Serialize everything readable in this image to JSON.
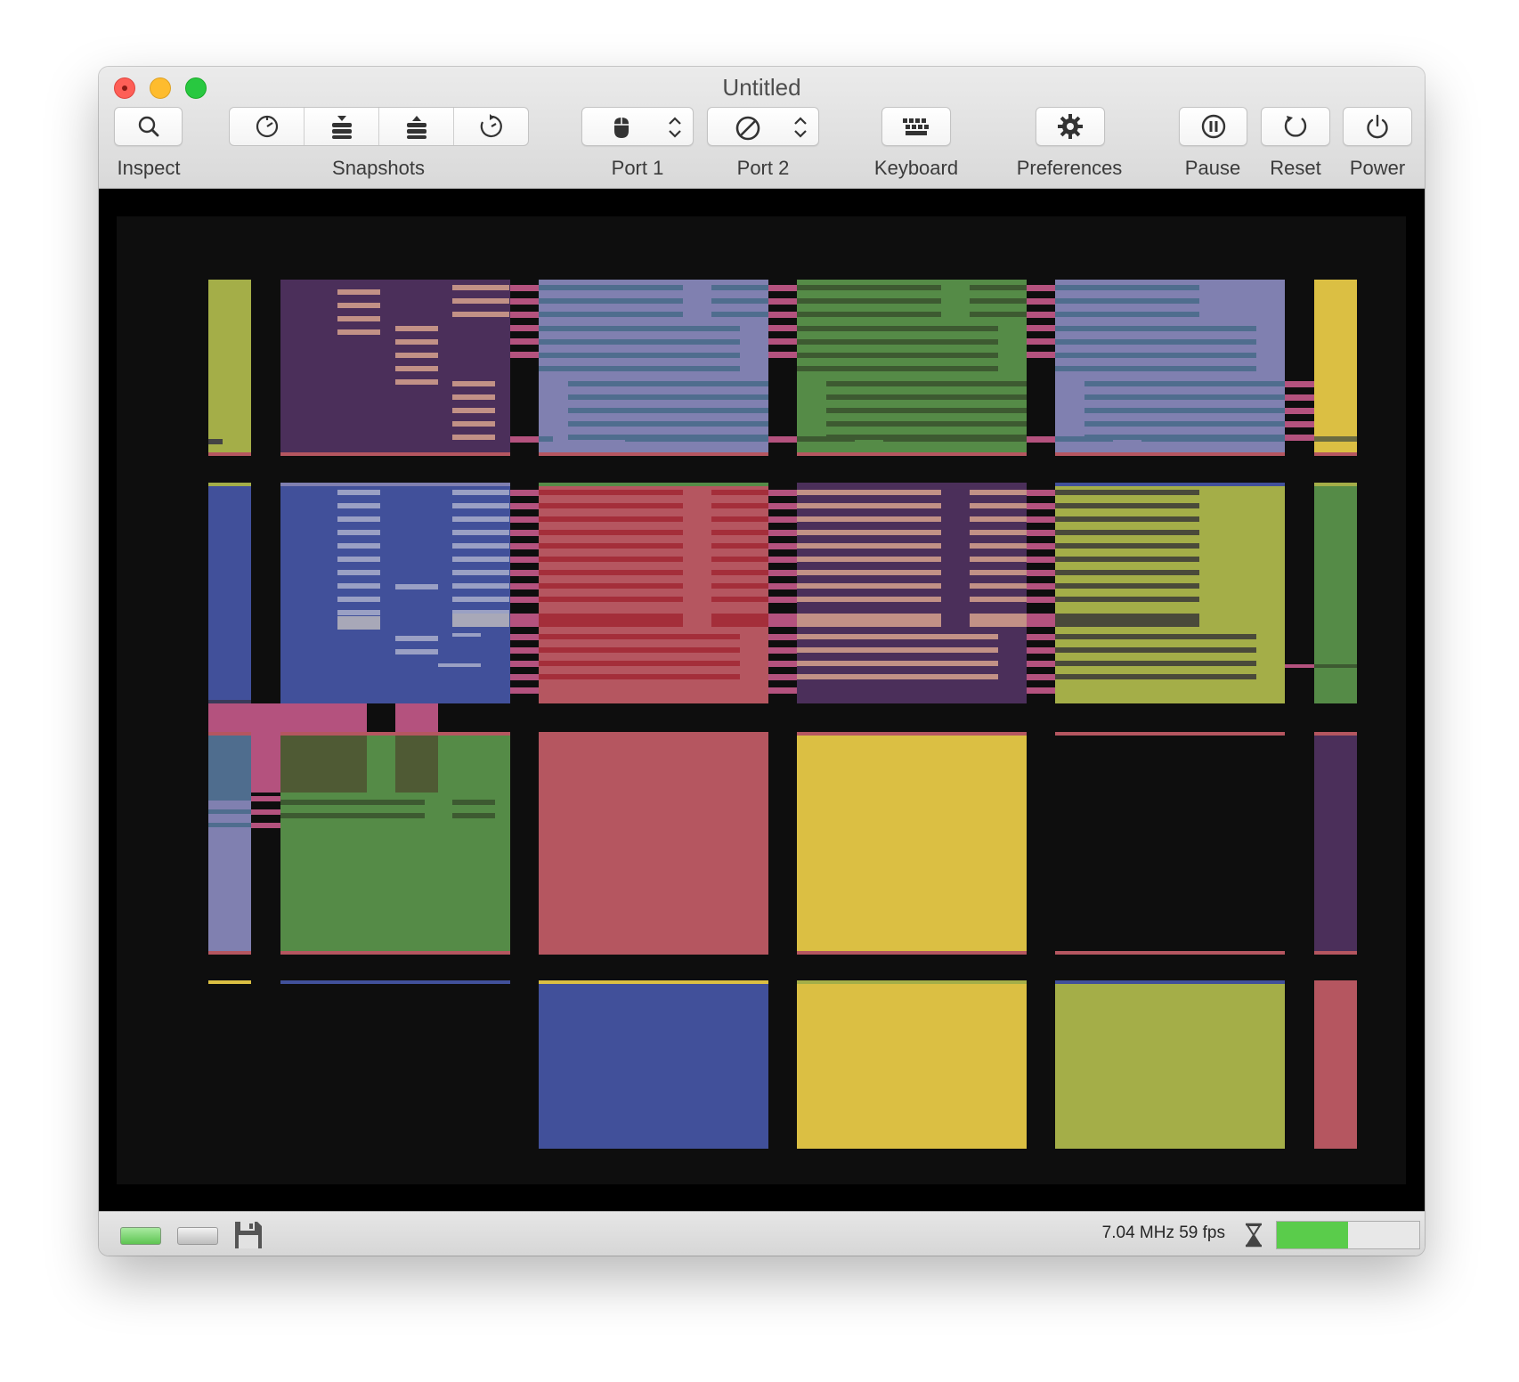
{
  "window": {
    "title": "Untitled"
  },
  "toolbar": {
    "inspect": {
      "label": "Inspect",
      "icon": "magnifier-icon"
    },
    "snapshots": {
      "label": "Snapshots",
      "buttons": [
        {
          "icon": "clock-icon"
        },
        {
          "icon": "stack-download-icon"
        },
        {
          "icon": "stack-upload-icon"
        },
        {
          "icon": "restore-icon"
        }
      ]
    },
    "port1": {
      "label": "Port 1",
      "icon": "mouse-icon"
    },
    "port2": {
      "label": "Port 2",
      "icon": "none-icon"
    },
    "keyboard": {
      "label": "Keyboard",
      "icon": "keyboard-icon"
    },
    "preferences": {
      "label": "Preferences",
      "icon": "gear-icon"
    },
    "pause": {
      "label": "Pause",
      "icon": "pause-icon"
    },
    "reset": {
      "label": "Reset",
      "icon": "reset-icon"
    },
    "power": {
      "label": "Power",
      "icon": "power-icon"
    }
  },
  "emulator_screen": {
    "palette": {
      "olive": "#a4ae48",
      "purple": "#4b2f5a",
      "periwinkle": "#8080b0",
      "green": "#558b47",
      "yellow": "#dbbf43",
      "blue": "#41509a",
      "red": "#b55660",
      "dark_red": "#a42e3a",
      "pink": "#b4527e",
      "peach": "#c29186",
      "slate": "#4f6d8e",
      "black": "#0e0e0e"
    }
  },
  "statusbar": {
    "drive1": {
      "icon": "drive-led-on-icon"
    },
    "drive2": {
      "icon": "drive-led-off-icon"
    },
    "disk": {
      "icon": "floppy-disk-icon"
    },
    "speed_text": "7.04 MHz 59 fps",
    "hourglass": {
      "icon": "hourglass-icon"
    },
    "performance_fraction": 0.5
  }
}
